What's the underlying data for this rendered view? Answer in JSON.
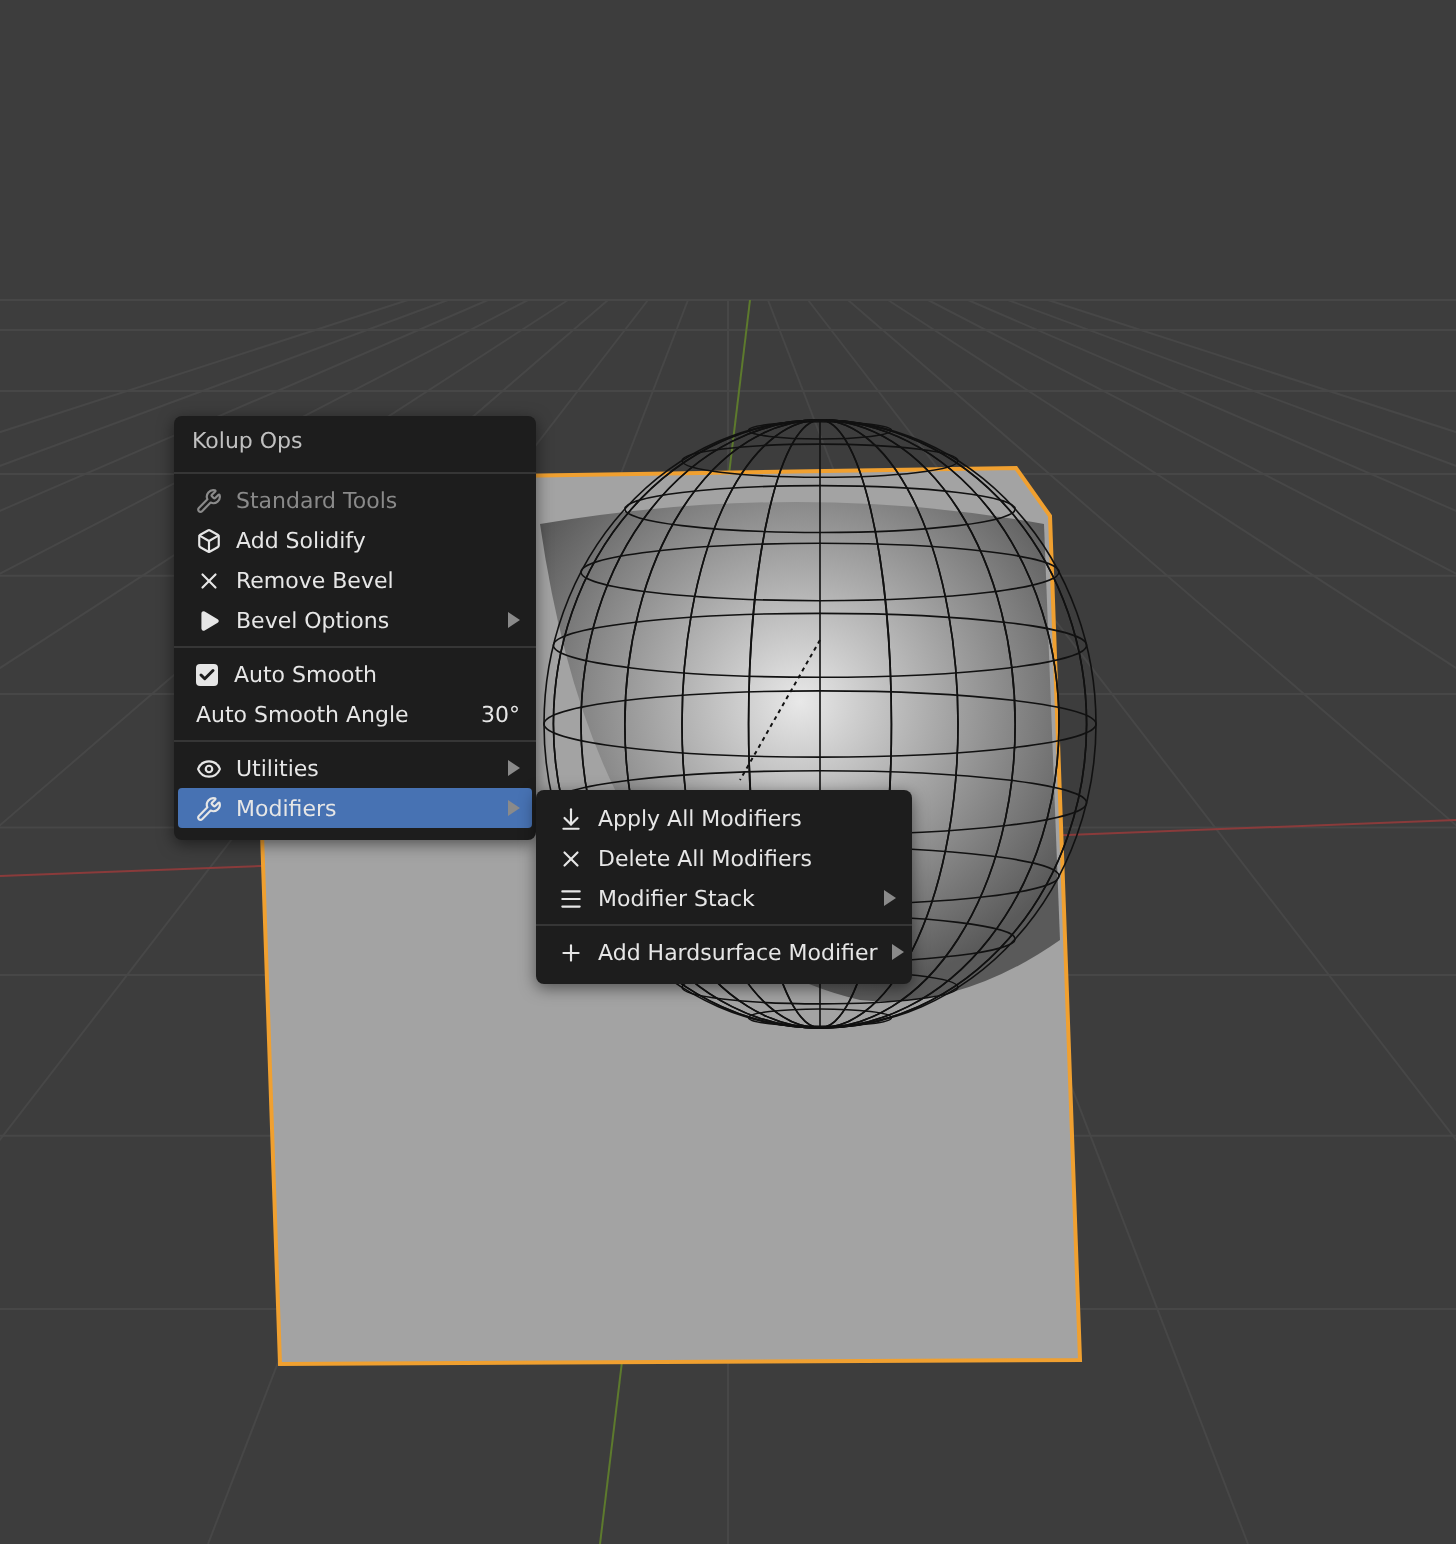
{
  "menu": {
    "title": "Kolup Ops",
    "sections": [
      {
        "items": [
          {
            "kind": "op",
            "label": "Standard Tools",
            "disabled": true,
            "submenu": false,
            "selected": false
          },
          {
            "kind": "op",
            "label": "Add Solidify",
            "disabled": false,
            "submenu": false,
            "selected": false
          },
          {
            "kind": "op",
            "label": "Remove Bevel",
            "disabled": false,
            "submenu": false,
            "selected": false
          },
          {
            "kind": "op",
            "label": "Bevel Options",
            "disabled": false,
            "submenu": true,
            "selected": false
          }
        ]
      },
      {
        "items": [
          {
            "kind": "checkbox",
            "label": "Auto Smooth",
            "checked": true
          },
          {
            "kind": "value",
            "label": "Auto Smooth Angle",
            "value": "30°"
          }
        ]
      },
      {
        "items": [
          {
            "kind": "op",
            "label": "Utilities",
            "disabled": false,
            "submenu": true,
            "selected": false
          },
          {
            "kind": "op",
            "label": "Modifiers",
            "disabled": false,
            "submenu": true,
            "selected": true
          }
        ]
      }
    ]
  },
  "submenu": {
    "sections": [
      {
        "items": [
          {
            "kind": "op",
            "label": "Apply All Modifiers",
            "disabled": false,
            "submenu": false,
            "selected": false
          },
          {
            "kind": "op",
            "label": "Delete All Modifiers",
            "disabled": false,
            "submenu": false,
            "selected": false
          },
          {
            "kind": "op",
            "label": "Modifier Stack",
            "disabled": false,
            "submenu": true,
            "selected": false
          }
        ]
      },
      {
        "items": [
          {
            "kind": "op",
            "label": "Add Hardsurface Modifier",
            "disabled": false,
            "submenu": true,
            "selected": false
          }
        ]
      }
    ]
  }
}
